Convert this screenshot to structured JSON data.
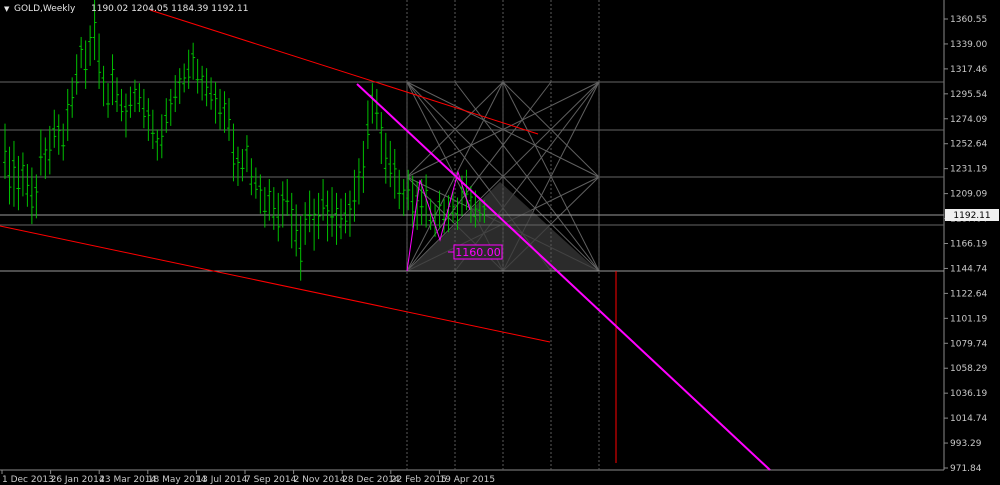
{
  "header": {
    "symbol": "GOLD,Weekly",
    "ohlc": "1190.02 1204.05 1184.39 1192.11"
  },
  "colors": {
    "background": "#000000",
    "bars": "#00c000",
    "channel": "#ff0000",
    "trendline": "#ff00ff",
    "grid": "#5a5a5a",
    "axis_text": "#c8c8c8"
  },
  "annotation": {
    "price_label": "1160.00"
  },
  "price_axis": {
    "ticks": [
      "1360.55",
      "1339.00",
      "1317.46",
      "1295.54",
      "1274.09",
      "1252.64",
      "1231.19",
      "1209.09",
      "1187.64",
      "1166.19",
      "1144.74",
      "1122.64",
      "1101.19",
      "1079.74",
      "1058.29",
      "1036.19",
      "1014.74",
      "993.29",
      "971.84"
    ],
    "current_price": "1192.11"
  },
  "time_axis": {
    "ticks": [
      "1 Dec 2013",
      "26 Jan 2014",
      "23 Mar 2014",
      "18 May 2014",
      "13 Jul 2014",
      "7 Sep 2014",
      "2 Nov 2014",
      "28 Dec 2014",
      "22 Feb 2015",
      "19 Apr 2015"
    ]
  },
  "chart_data": {
    "type": "ohlc",
    "title": "GOLD,Weekly",
    "timeframe": "Weekly",
    "ylim": [
      966,
      1373
    ],
    "last_bar": {
      "open": 1190.02,
      "high": 1204.05,
      "low": 1184.39,
      "close": 1192.11
    },
    "x_ticks": [
      "1 Dec 2013",
      "26 Jan 2014",
      "23 Mar 2014",
      "18 May 2014",
      "13 Jul 2014",
      "7 Sep 2014",
      "2 Nov 2014",
      "28 Dec 2014",
      "22 Feb 2015",
      "19 Apr 2015"
    ],
    "bars_high_low": [
      [
        1270,
        1222
      ],
      [
        1250,
        1200
      ],
      [
        1255,
        1198
      ],
      [
        1242,
        1195
      ],
      [
        1245,
        1207
      ],
      [
        1235,
        1198
      ],
      [
        1232,
        1183
      ],
      [
        1226,
        1188
      ],
      [
        1265,
        1225
      ],
      [
        1258,
        1222
      ],
      [
        1268,
        1226
      ],
      [
        1282,
        1249
      ],
      [
        1278,
        1243
      ],
      [
        1270,
        1238
      ],
      [
        1300,
        1255
      ],
      [
        1310,
        1275
      ],
      [
        1330,
        1295
      ],
      [
        1345,
        1318
      ],
      [
        1342,
        1300
      ],
      [
        1355,
        1320
      ],
      [
        1390,
        1325
      ],
      [
        1348,
        1300
      ],
      [
        1320,
        1285
      ],
      [
        1305,
        1275
      ],
      [
        1330,
        1286
      ],
      [
        1310,
        1280
      ],
      [
        1300,
        1272
      ],
      [
        1296,
        1258
      ],
      [
        1302,
        1275
      ],
      [
        1308,
        1280
      ],
      [
        1305,
        1280
      ],
      [
        1300,
        1266
      ],
      [
        1292,
        1255
      ],
      [
        1282,
        1248
      ],
      [
        1265,
        1238
      ],
      [
        1278,
        1240
      ],
      [
        1292,
        1262
      ],
      [
        1300,
        1268
      ],
      [
        1312,
        1280
      ],
      [
        1318,
        1287
      ],
      [
        1322,
        1297
      ],
      [
        1334,
        1300
      ],
      [
        1340,
        1308
      ],
      [
        1326,
        1296
      ],
      [
        1320,
        1290
      ],
      [
        1318,
        1285
      ],
      [
        1310,
        1282
      ],
      [
        1306,
        1270
      ],
      [
        1300,
        1265
      ],
      [
        1298,
        1262
      ],
      [
        1292,
        1255
      ],
      [
        1270,
        1220
      ],
      [
        1250,
        1216
      ],
      [
        1248,
        1220
      ],
      [
        1260,
        1228
      ],
      [
        1240,
        1208
      ],
      [
        1232,
        1205
      ],
      [
        1226,
        1192
      ],
      [
        1215,
        1180
      ],
      [
        1222,
        1186
      ],
      [
        1215,
        1178
      ],
      [
        1210,
        1168
      ],
      [
        1220,
        1180
      ],
      [
        1222,
        1190
      ],
      [
        1210,
        1162
      ],
      [
        1200,
        1155
      ],
      [
        1190,
        1134
      ],
      [
        1202,
        1165
      ],
      [
        1212,
        1176
      ],
      [
        1205,
        1160
      ],
      [
        1210,
        1170
      ],
      [
        1222,
        1186
      ],
      [
        1212,
        1168
      ],
      [
        1215,
        1172
      ],
      [
        1210,
        1165
      ],
      [
        1205,
        1170
      ],
      [
        1210,
        1175
      ],
      [
        1212,
        1172
      ],
      [
        1230,
        1185
      ],
      [
        1240,
        1200
      ],
      [
        1255,
        1210
      ],
      [
        1290,
        1248
      ],
      [
        1305,
        1270
      ],
      [
        1300,
        1265
      ],
      [
        1280,
        1235
      ],
      [
        1262,
        1218
      ],
      [
        1255,
        1215
      ],
      [
        1248,
        1205
      ],
      [
        1230,
        1196
      ],
      [
        1222,
        1190
      ],
      [
        1230,
        1195
      ],
      [
        1225,
        1180
      ],
      [
        1220,
        1178
      ],
      [
        1222,
        1182
      ],
      [
        1226,
        1180
      ],
      [
        1205,
        1178
      ],
      [
        1200,
        1172
      ],
      [
        1212,
        1180
      ],
      [
        1205,
        1175
      ],
      [
        1208,
        1176
      ],
      [
        1212,
        1184
      ],
      [
        1206,
        1178
      ],
      [
        1225,
        1190
      ],
      [
        1230,
        1195
      ],
      [
        1216,
        1184
      ],
      [
        1212,
        1180
      ],
      [
        1205,
        1185
      ],
      [
        1204,
        1184
      ]
    ]
  }
}
